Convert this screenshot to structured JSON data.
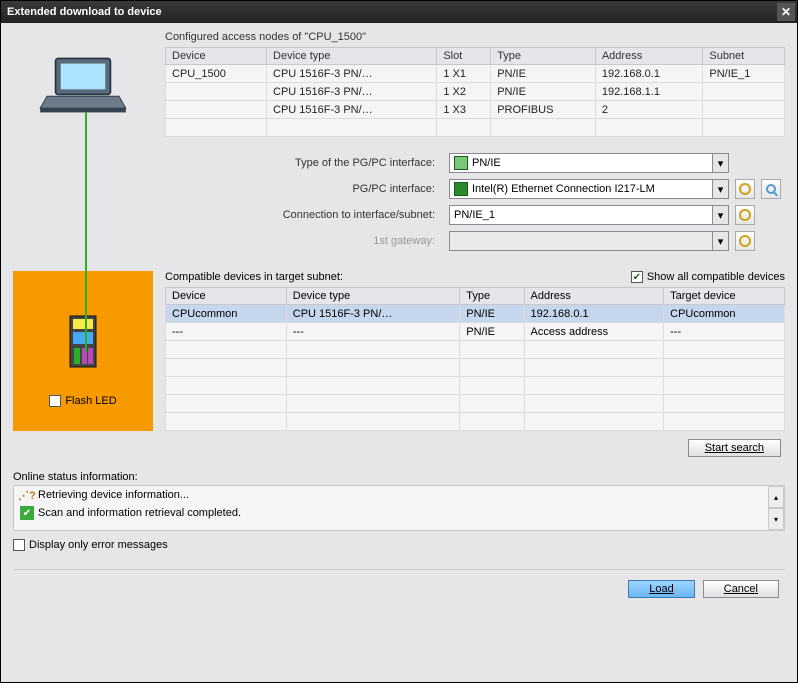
{
  "title": "Extended download to device",
  "close_label": "✕",
  "nodes_caption": "Configured access nodes of \"CPU_1500\"",
  "nodes_columns": {
    "c0": "Device",
    "c1": "Device type",
    "c2": "Slot",
    "c3": "Type",
    "c4": "Address",
    "c5": "Subnet"
  },
  "nodes_rows": [
    {
      "device": "CPU_1500",
      "dtype": "CPU 1516F-3 PN/…",
      "slot": "1 X1",
      "type": "PN/IE",
      "addr": "192.168.0.1",
      "subnet": "PN/IE_1"
    },
    {
      "device": "",
      "dtype": "CPU 1516F-3 PN/…",
      "slot": "1 X2",
      "type": "PN/IE",
      "addr": "192.168.1.1",
      "subnet": ""
    },
    {
      "device": "",
      "dtype": "CPU 1516F-3 PN/…",
      "slot": "1 X3",
      "type": "PROFIBUS",
      "addr": "2",
      "subnet": ""
    }
  ],
  "iface": {
    "type_label": "Type of the PG/PC interface:",
    "pgpc_label": "PG/PC interface:",
    "conn_label": "Connection to interface/subnet:",
    "gw_label": "1st gateway:",
    "type_value": "PN/IE",
    "pgpc_value": "Intel(R) Ethernet Connection I217-LM",
    "conn_value": "PN/IE_1",
    "gw_value": ""
  },
  "compat": {
    "caption": "Compatible devices in target subnet:",
    "show_all_label": "Show all compatible devices",
    "columns": {
      "c0": "Device",
      "c1": "Device type",
      "c2": "Type",
      "c3": "Address",
      "c4": "Target device"
    },
    "rows": [
      {
        "device": "CPUcommon",
        "dtype": "CPU 1516F-3 PN/…",
        "type": "PN/IE",
        "addr": "192.168.0.1",
        "target": "CPUcommon",
        "selected": true
      },
      {
        "device": "---",
        "dtype": "---",
        "type": "PN/IE",
        "addr": "Access address",
        "target": "---",
        "selected": false
      }
    ],
    "flash_led_label": "Flash LED",
    "start_search": "Start search"
  },
  "status": {
    "caption": "Online status information:",
    "items": [
      {
        "icon": "busy",
        "text": "Retrieving device information..."
      },
      {
        "icon": "ok",
        "text": "Scan and information retrieval completed."
      }
    ],
    "display_err_label": "Display only error messages"
  },
  "footer": {
    "load": "Load",
    "cancel": "Cancel"
  }
}
